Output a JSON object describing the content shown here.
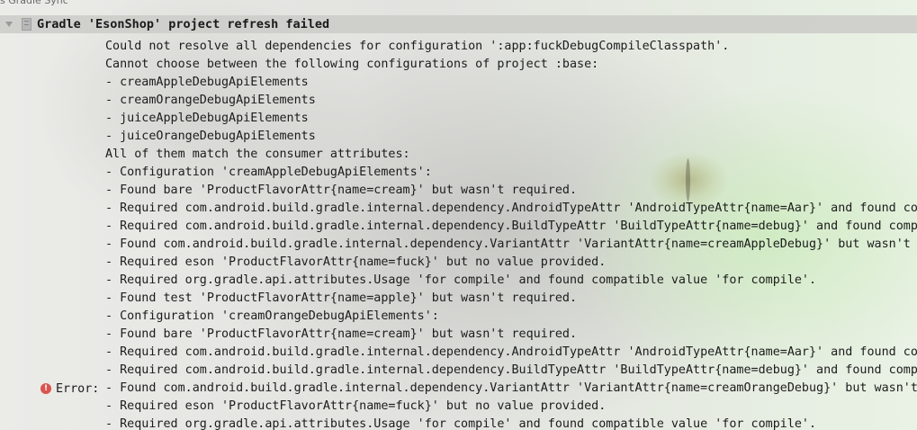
{
  "window": {
    "title": "s Gradle Sync"
  },
  "header": {
    "title": "Gradle 'EsonShop' project refresh failed"
  },
  "error_marker": {
    "label": "Error:"
  },
  "log_lines": [
    "Could not resolve all dependencies for configuration ':app:fuckDebugCompileClasspath'.",
    "Cannot choose between the following configurations of project :base:",
    "- creamAppleDebugApiElements",
    "- creamOrangeDebugApiElements",
    "- juiceAppleDebugApiElements",
    "- juiceOrangeDebugApiElements",
    "All of them match the consumer attributes:",
    "- Configuration 'creamAppleDebugApiElements':",
    "- Found bare 'ProductFlavorAttr{name=cream}' but wasn't required.",
    "- Required com.android.build.gradle.internal.dependency.AndroidTypeAttr 'AndroidTypeAttr{name=Aar}' and found com",
    "- Required com.android.build.gradle.internal.dependency.BuildTypeAttr 'BuildTypeAttr{name=debug}' and found compa",
    "- Found com.android.build.gradle.internal.dependency.VariantAttr 'VariantAttr{name=creamAppleDebug}' but wasn't r",
    "- Required eson 'ProductFlavorAttr{name=fuck}' but no value provided.",
    "- Required org.gradle.api.attributes.Usage 'for compile' and found compatible value 'for compile'.",
    "- Found test 'ProductFlavorAttr{name=apple}' but wasn't required.",
    "- Configuration 'creamOrangeDebugApiElements':",
    "- Found bare 'ProductFlavorAttr{name=cream}' but wasn't required.",
    "- Required com.android.build.gradle.internal.dependency.AndroidTypeAttr 'AndroidTypeAttr{name=Aar}' and found com",
    "- Required com.android.build.gradle.internal.dependency.BuildTypeAttr 'BuildTypeAttr{name=debug}' and found compa",
    "- Found com.android.build.gradle.internal.dependency.VariantAttr 'VariantAttr{name=creamOrangeDebug}' but wasn't",
    "- Required eson 'ProductFlavorAttr{name=fuck}' but no value provided.",
    "- Required org.gradle.api.attributes.Usage 'for compile' and found compatible value 'for compile'."
  ],
  "colors": {
    "error": "#d9534f",
    "header_bg": "#cdcdca",
    "text": "#1c1c1c"
  },
  "icons": {
    "toggle": "expand-arrow-icon",
    "gradle": "gradle-sync-icon",
    "error": "error-icon"
  }
}
